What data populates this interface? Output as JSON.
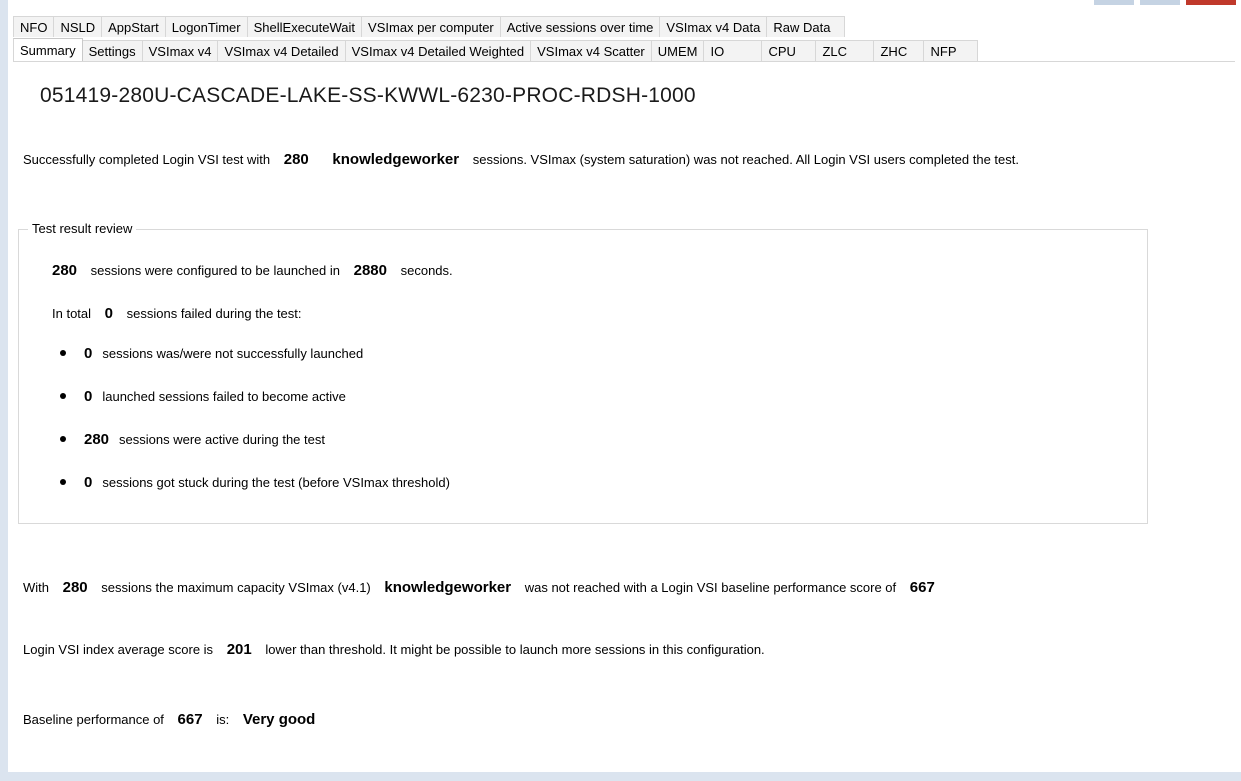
{
  "tabs_row1": [
    "NFO",
    "NSLD",
    "AppStart",
    "LogonTimer",
    "ShellExecuteWait",
    "VSImax per computer",
    "Active sessions over time",
    "VSImax v4 Data",
    "Raw Data"
  ],
  "tabs_row2": [
    "Summary",
    "Settings",
    "VSImax v4",
    "VSImax v4 Detailed",
    "VSImax v4 Detailed Weighted",
    "VSImax v4 Scatter",
    "UMEM",
    "IO",
    "CPU",
    "ZLC",
    "ZHC",
    "NFP"
  ],
  "active_tab": "Summary",
  "colors": {
    "edge": "#dbe4ef",
    "tab_bg": "#f3f3f3",
    "border": "#d7d7d7"
  },
  "summary": {
    "title": "051419-280U-CASCADE-LAKE-SS-KWWL-6230-PROC-RDSH-1000",
    "completed": {
      "p1": "Successfully completed Login VSI test with",
      "sessions": "280",
      "workload": "knowledgeworker",
      "p2": "sessions. VSImax (system saturation) was not reached. All Login VSI users completed the test."
    },
    "review": {
      "legend": "Test result review",
      "configured": {
        "count": "280",
        "p1": "sessions were configured to be launched in",
        "seconds": "2880",
        "p2": "seconds."
      },
      "failed": {
        "p1": "In total",
        "count": "0",
        "p2": "sessions failed during the test:"
      },
      "items": [
        {
          "count": "0",
          "text": "sessions was/were not successfully launched"
        },
        {
          "count": "0",
          "text": "launched sessions failed to become active"
        },
        {
          "count": "280",
          "text": "sessions were active during the test"
        },
        {
          "count": "0",
          "text": "sessions got stuck during the test (before VSImax threshold)"
        }
      ]
    },
    "capacity": {
      "p1": "With",
      "sessions": "280",
      "p2": "sessions the maximum capacity VSImax (v4.1)",
      "workload": "knowledgeworker",
      "p3": "was not reached with a Login VSI baseline performance score of",
      "score": "667"
    },
    "index": {
      "p1": "Login VSI index average score is",
      "score": "201",
      "p2": "lower than threshold. It might be possible to launch more sessions in this configuration."
    },
    "baseline": {
      "p1": "Baseline performance of",
      "score": "667",
      "p2": "is:",
      "rating": "Very good"
    }
  }
}
